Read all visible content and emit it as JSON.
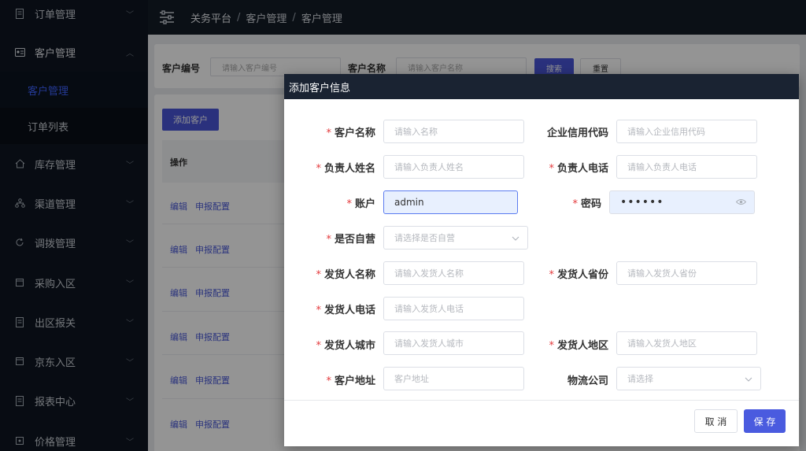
{
  "sidebar": {
    "items": [
      {
        "label": "订单管理",
        "icon": "document-icon"
      },
      {
        "label": "客户管理",
        "icon": "id-card-icon"
      },
      {
        "label": "库存管理",
        "icon": "home-icon"
      },
      {
        "label": "渠道管理",
        "icon": "network-icon"
      },
      {
        "label": "调拨管理",
        "icon": "refresh-icon"
      },
      {
        "label": "采购入区",
        "icon": "box-icon"
      },
      {
        "label": "出区报关",
        "icon": "document-icon"
      },
      {
        "label": "京东入区",
        "icon": "box-icon"
      },
      {
        "label": "报表中心",
        "icon": "document-icon"
      },
      {
        "label": "价格管理",
        "icon": "tag-icon"
      }
    ],
    "submenu": [
      {
        "label": "客户管理",
        "active": true
      },
      {
        "label": "订单列表",
        "active": false
      }
    ],
    "active_color": "#3f63ff"
  },
  "header": {
    "breadcrumb": [
      "关务平台",
      "客户管理",
      "客户管理"
    ],
    "separator": "/"
  },
  "search": {
    "customer_code_label": "客户编号",
    "customer_code_placeholder": "请输入客户编号",
    "customer_name_label": "客户名称",
    "customer_name_placeholder": "请输入客户名称",
    "search_button": "搜索",
    "reset_button": "重置"
  },
  "table": {
    "add_button": "添加客户",
    "header_operation": "操作",
    "rows": [
      {
        "edit": "编辑",
        "config": "申报配置"
      },
      {
        "edit": "编辑",
        "config": "申报配置"
      },
      {
        "edit": "编辑",
        "config": "申报配置"
      },
      {
        "edit": "编辑",
        "config": "申报配置"
      },
      {
        "edit": "编辑",
        "config": "申报配置"
      },
      {
        "edit": "编辑",
        "config": "申报配置"
      }
    ]
  },
  "modal": {
    "title": "添加客户信息",
    "fields": {
      "customer_name": {
        "label": "客户名称",
        "placeholder": "请输入名称",
        "required": true
      },
      "credit_code": {
        "label": "企业信用代码",
        "placeholder": "请输入企业信用代码",
        "required": false
      },
      "owner_name": {
        "label": "负责人姓名",
        "placeholder": "请输入负责人姓名",
        "required": true
      },
      "owner_phone": {
        "label": "负责人电话",
        "placeholder": "请输入负责人电话",
        "required": true
      },
      "account": {
        "label": "账户",
        "value": "admin",
        "required": true
      },
      "password": {
        "label": "密码",
        "value": "••••••",
        "required": true
      },
      "self_operated": {
        "label": "是否自营",
        "placeholder": "请选择是否自营",
        "required": true
      },
      "sender_name": {
        "label": "发货人名称",
        "placeholder": "请输入发货人名称",
        "required": true
      },
      "sender_province": {
        "label": "发货人省份",
        "placeholder": "请输入发货人省份",
        "required": true
      },
      "sender_phone": {
        "label": "发货人电话",
        "placeholder": "请输入发货人电话",
        "required": true
      },
      "sender_city": {
        "label": "发货人城市",
        "placeholder": "请输入发货人城市",
        "required": true
      },
      "sender_region": {
        "label": "发货人地区",
        "placeholder": "请输入发货人地区",
        "required": true
      },
      "customer_address": {
        "label": "客户地址",
        "placeholder": "客户地址",
        "required": true
      },
      "logistics": {
        "label": "物流公司",
        "placeholder": "请选择",
        "required": false
      }
    },
    "required_mark": "*",
    "cancel_button": "取 消",
    "save_button": "保 存"
  }
}
